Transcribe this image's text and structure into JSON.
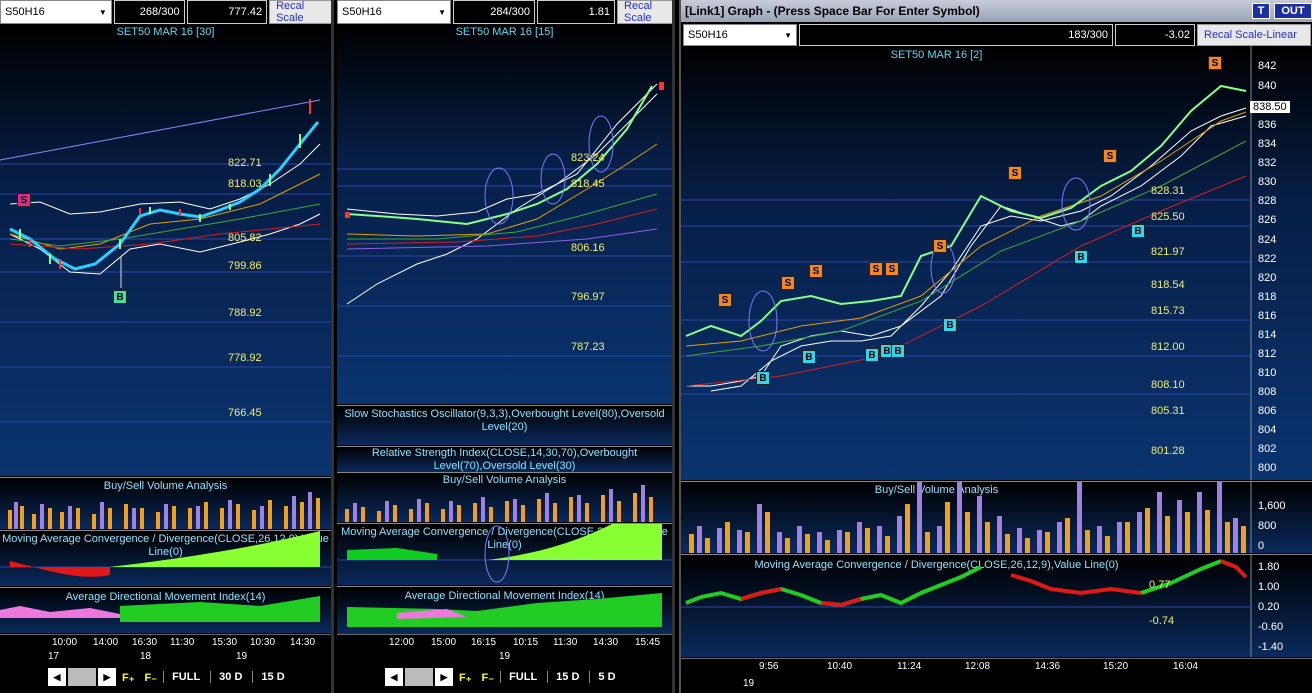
{
  "panel1": {
    "symbol": "S50H16",
    "count": "268/300",
    "value": "777.42",
    "recal": "Recal Scale",
    "title": "SET50 MAR 16  [30]",
    "levels": [
      "822.71",
      "818.03",
      "805.82",
      "799.86",
      "788.92",
      "778.92",
      "766.45"
    ],
    "signals": {
      "s": "S",
      "b": "B"
    },
    "sub1": "Buy/Sell Volume Analysis",
    "sub2": "Moving Average Convergence / Divergence(CLOSE,26,12,9),Value Line(0)",
    "sub3": "Average Directional Movement Index(14)",
    "times": [
      "10:00",
      "14:00",
      "16:30",
      "11:30",
      "15:30",
      "10:30",
      "14:30"
    ],
    "dates": [
      "17",
      "18",
      "19"
    ],
    "periods": [
      "FULL",
      "30 D",
      "15 D"
    ]
  },
  "panel2": {
    "symbol": "S50H16",
    "count": "284/300",
    "value": "1.81",
    "recal": "Recal Scale",
    "title": "SET50 MAR 16  [15]",
    "levels": [
      "823.24",
      "818.45",
      "806.16",
      "796.97",
      "787.23"
    ],
    "sub0": "Slow Stochastics Oscillator(9,3,3),Overbought Level(80),Oversold Level(20)",
    "sub1": "Relative Strength Index(CLOSE,14,30,70),Overbought Level(70),Oversold Level(30)",
    "sub2": "Buy/Sell Volume Analysis",
    "sub3": "Moving Average Convergence / Divergence(CLOSE,26,12,9),Value Line(0)",
    "sub4": "Average Directional Movement Index(14)",
    "times": [
      "12:00",
      "15:00",
      "16:15",
      "10:15",
      "11:30",
      "14:30",
      "15:45"
    ],
    "dates": [
      "19"
    ],
    "periods": [
      "FULL",
      "15 D",
      "5 D"
    ]
  },
  "panel3": {
    "window_title": "[Link1] Graph  - (Press Space Bar For Enter Symbol)",
    "t_btn": "T",
    "out_btn": "OUT",
    "symbol": "S50H16",
    "count": "183/300",
    "value": "-3.02",
    "recal": "Recal Scale-Linear",
    "title": "SET50 MAR 16  [2]",
    "price": "838.50",
    "levels": [
      "828.31",
      "825.50",
      "821.97",
      "818.54",
      "815.73",
      "812.00",
      "808.10",
      "805.31",
      "801.28"
    ],
    "yaxis": [
      "842",
      "840",
      "838",
      "836",
      "834",
      "832",
      "830",
      "828",
      "826",
      "824",
      "822",
      "820",
      "818",
      "816",
      "814",
      "812",
      "810",
      "808",
      "806",
      "804",
      "802",
      "800"
    ],
    "vol_title": "Buy/Sell Volume Analysis",
    "vol_axis": [
      "1,600",
      "800",
      "0"
    ],
    "macd_title": "Moving Average Convergence / Divergence(CLOSE,26,12,9),Value Line(0)",
    "macd_axis": [
      "1.80",
      "1.00",
      "0.20",
      "-0.60",
      "-1.40"
    ],
    "macd_labels": [
      "0.77",
      "-0.74"
    ],
    "times": [
      "9:56",
      "10:40",
      "11:24",
      "12:08",
      "14:36",
      "15:20",
      "16:04"
    ],
    "dates": [
      "19"
    ]
  },
  "fbtn": {
    "plus": "F₊",
    "minus": "F₋"
  }
}
